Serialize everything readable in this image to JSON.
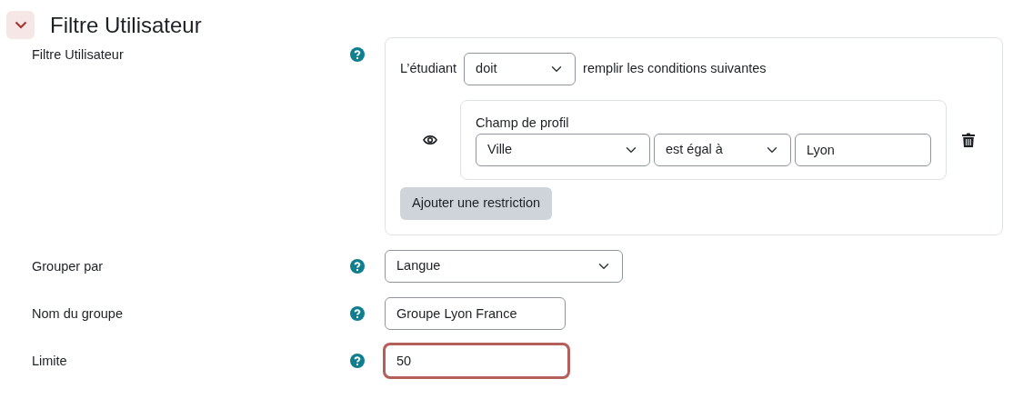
{
  "section": {
    "title": "Filtre Utilisateur",
    "expanded": true
  },
  "fields": [
    {
      "kind": "availability",
      "label": "Filtre Utilisateur",
      "prefix": "L’étudiant",
      "mode": "doit",
      "suffix": "remplir les conditions suivantes",
      "conditions": [
        {
          "title": "Champ de profil",
          "visible": true,
          "field": "Ville",
          "operator": "est égal à",
          "value": "Lyon"
        }
      ],
      "add_button": "Ajouter une restriction"
    },
    {
      "kind": "select",
      "label": "Grouper par",
      "value": "Langue"
    },
    {
      "kind": "text",
      "label": "Nom du groupe",
      "value": "Groupe Lyon France",
      "focused": false
    },
    {
      "kind": "text",
      "label": "Limite",
      "value": "50",
      "focused": true
    }
  ]
}
